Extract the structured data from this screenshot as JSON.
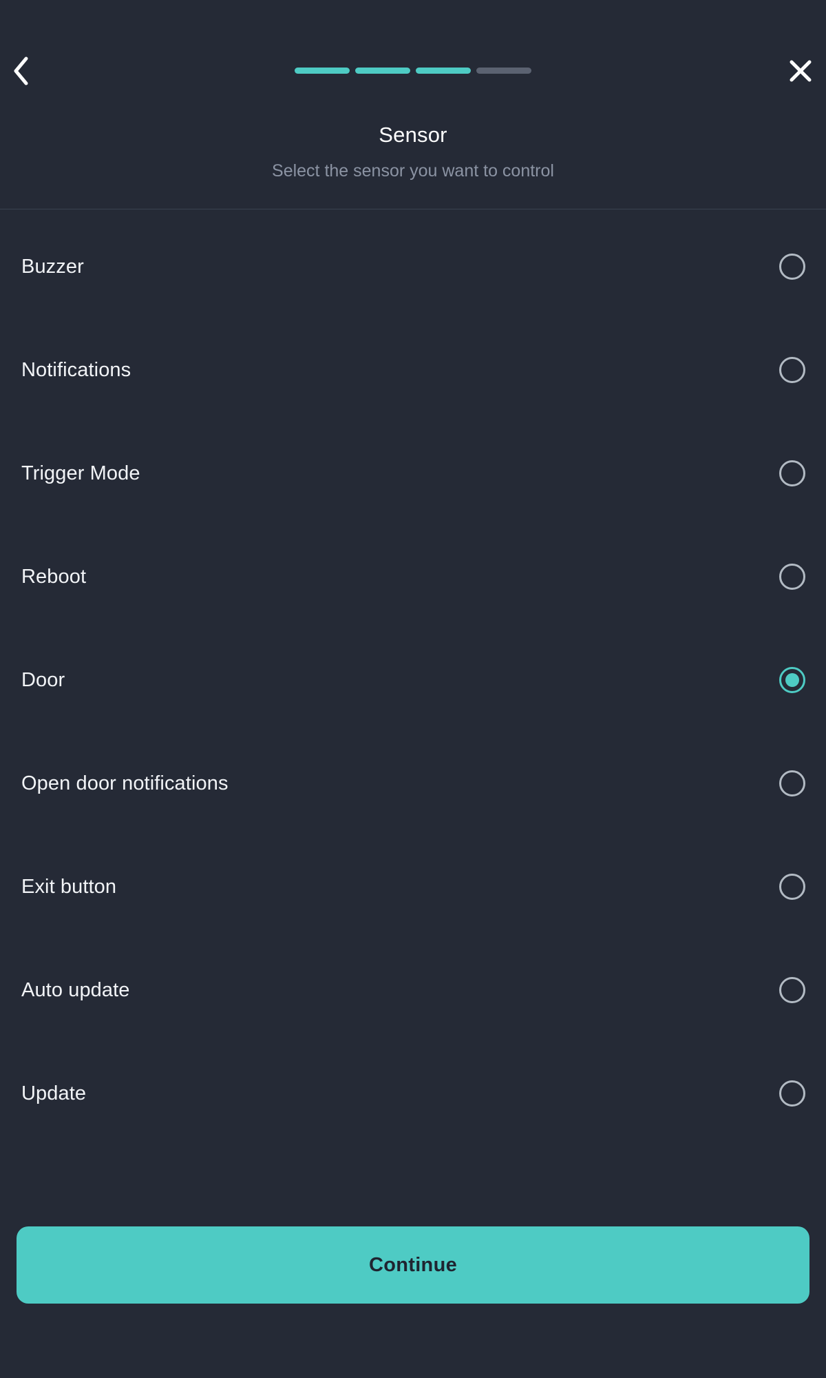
{
  "theme": {
    "background": "#252a36",
    "accent": "#4ecbc4",
    "divider": "#3a4250",
    "text_primary": "#f2f4f7",
    "text_secondary": "#8b93a3",
    "radio_idle": "#b2bac3",
    "progress_idle": "#5b6271"
  },
  "header": {
    "back_icon": "chevron-left-icon",
    "close_icon": "close-x-icon",
    "title": "Sensor",
    "subtitle": "Select the sensor you want to control",
    "progress": {
      "total_steps": 4,
      "completed_steps": 3,
      "steps": [
        {
          "state": "done"
        },
        {
          "state": "done"
        },
        {
          "state": "done"
        },
        {
          "state": "todo"
        }
      ]
    }
  },
  "list": {
    "items": [
      {
        "label": "Buzzer",
        "selected": false
      },
      {
        "label": "Notifications",
        "selected": false
      },
      {
        "label": "Trigger Mode",
        "selected": false
      },
      {
        "label": "Reboot",
        "selected": false
      },
      {
        "label": "Door",
        "selected": true
      },
      {
        "label": "Open door notifications",
        "selected": false
      },
      {
        "label": "Exit button",
        "selected": false
      },
      {
        "label": "Auto update",
        "selected": false
      },
      {
        "label": "Update",
        "selected": false
      }
    ]
  },
  "footer": {
    "continue_label": "Continue"
  }
}
